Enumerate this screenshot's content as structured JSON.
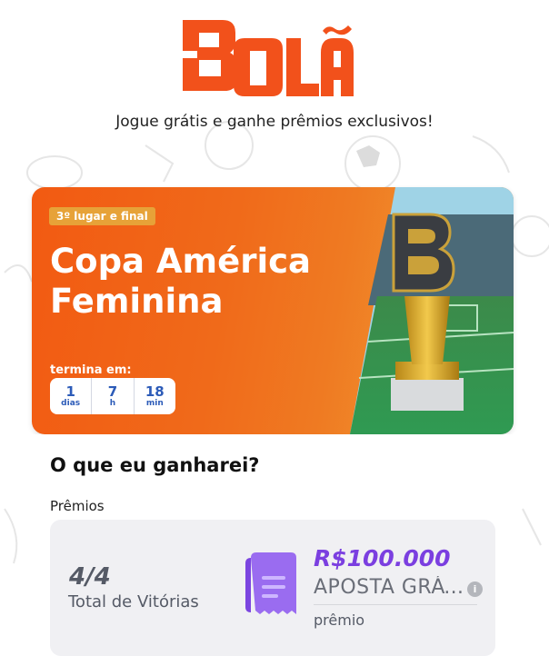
{
  "brand": {
    "logo_text": "BOLÃO",
    "tagline": "Jogue grátis e ganhe prêmios exclusivos!",
    "accent_color": "#f2511b"
  },
  "tournament": {
    "stage_badge": "3º lugar e final",
    "title_line1": "Copa América",
    "title_line2": "Feminina",
    "ends_label": "termina em:",
    "countdown": [
      {
        "value": "1",
        "unit": "dias"
      },
      {
        "value": "7",
        "unit": "h"
      },
      {
        "value": "18",
        "unit": "min"
      }
    ],
    "trophy_icon": "trophy-b-icon"
  },
  "rewards": {
    "section_title": "O que eu ganharei?",
    "prizes_label": "Prêmios",
    "items": [
      {
        "score": "4/4",
        "score_label": "Total de Vitórias",
        "amount": "R$100.000",
        "name": "APOSTA GRÁTIS",
        "sub_label": "prêmio",
        "icon": "ticket-icon",
        "info_icon": "i"
      }
    ]
  }
}
